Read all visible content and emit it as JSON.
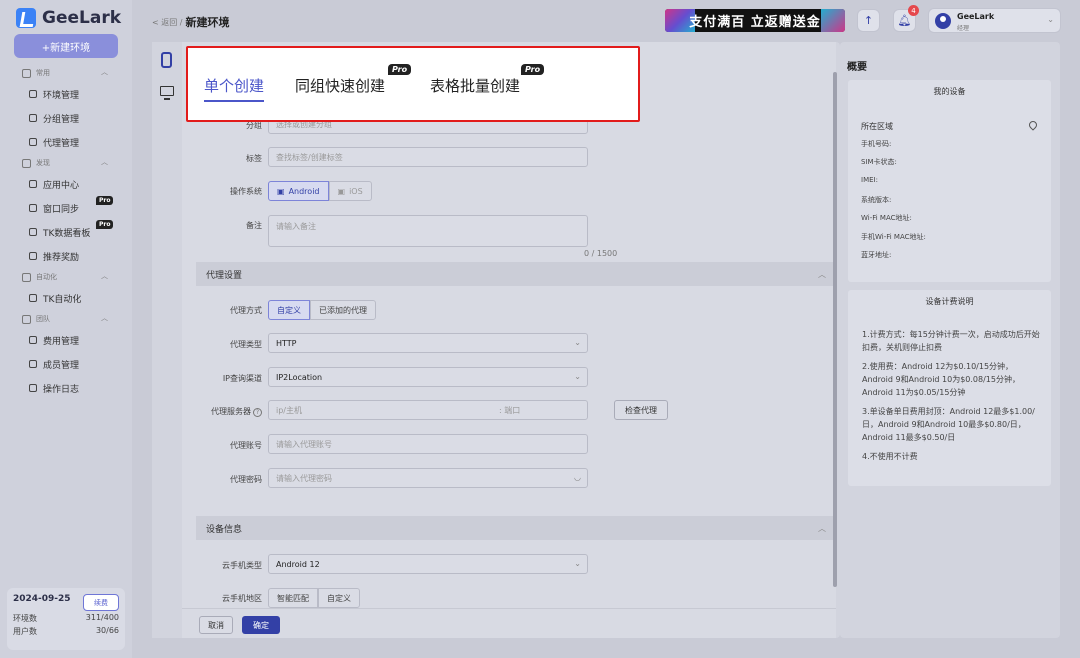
{
  "app": {
    "name": "GeeLark"
  },
  "sidebar": {
    "new_env_label": "+新建环境",
    "groups": [
      {
        "label": "常用",
        "items": [
          {
            "label": "环境管理"
          },
          {
            "label": "分组管理"
          },
          {
            "label": "代理管理"
          }
        ]
      },
      {
        "label": "发现",
        "items": [
          {
            "label": "应用中心"
          },
          {
            "label": "窗口同步",
            "badge": "Pro"
          },
          {
            "label": "TK数据看板",
            "badge": "Pro"
          },
          {
            "label": "推荐奖励"
          }
        ]
      },
      {
        "label": "自动化",
        "items": [
          {
            "label": "TK自动化"
          }
        ]
      },
      {
        "label": "团队",
        "items": [
          {
            "label": "费用管理"
          },
          {
            "label": "成员管理"
          },
          {
            "label": "操作日志"
          }
        ]
      }
    ],
    "account": {
      "date": "2024-09-25",
      "renew_label": "续费",
      "env_count_label": "环境数",
      "env_count_value": "311/400",
      "user_count_label": "用户数",
      "user_count_value": "30/66"
    }
  },
  "header": {
    "back_label": "< 返回 /",
    "title": "新建环境",
    "promo_text": "支付满百 立返赠送金",
    "notification_count": "4",
    "user_name": "GeeLark",
    "user_role": "经理"
  },
  "tabs": {
    "single": "单个创建",
    "group_quick": "同组快速创建",
    "batch_table": "表格批量创建",
    "pro_badge": "Pro"
  },
  "form": {
    "group_label": "分组",
    "group_placeholder": "选择或创建分组",
    "tag_label": "标签",
    "tag_placeholder": "查找标签/创建标签",
    "os_label": "操作系统",
    "os_options": [
      "Android",
      "iOS"
    ],
    "note_label": "备注",
    "note_placeholder": "请输入备注",
    "note_counter": "0 / 1500",
    "proxy_section": "代理设置",
    "proxy_method_label": "代理方式",
    "proxy_method_options": [
      "自定义",
      "已添加的代理"
    ],
    "proxy_type_label": "代理类型",
    "proxy_type_value": "HTTP",
    "ip_channel_label": "IP查询渠道",
    "ip_channel_value": "IP2Location",
    "proxy_server_label": "代理服务器",
    "proxy_server_host_placeholder": "ip/主机",
    "proxy_server_port_placeholder": ": 端口",
    "check_proxy_label": "检查代理",
    "proxy_account_label": "代理账号",
    "proxy_account_placeholder": "请输入代理账号",
    "proxy_password_label": "代理密码",
    "proxy_password_placeholder": "请输入代理密码",
    "device_section": "设备信息",
    "phone_type_label": "云手机类型",
    "phone_type_value": "Android 12",
    "phone_region_label": "云手机地区",
    "phone_region_options": [
      "智能匹配",
      "自定义"
    ],
    "cancel_label": "取消",
    "ok_label": "确定"
  },
  "summary": {
    "title": "概要",
    "my_device": "我的设备",
    "region_label": "所在区域",
    "fields": [
      "手机号码:",
      "SIM卡状态:",
      "IMEI:",
      "系统版本:",
      "Wi-Fi MAC地址:",
      "手机Wi-Fi MAC地址:",
      "蓝牙地址:"
    ],
    "fee_title": "设备计费说明",
    "fee_items": [
      "1.计费方式：每15分钟计费一次，启动成功后开始扣费，关机则停止扣费",
      "2.使用费：Android 12为$0.10/15分钟，Android 9和Android 10为$0.08/15分钟，Android 11为$0.05/15分钟",
      "3.单设备单日费用封顶：Android 12最多$1.00/日，Android 9和Android 10最多$0.80/日，Android 11最多$0.50/日",
      "4.不使用不计费"
    ]
  }
}
